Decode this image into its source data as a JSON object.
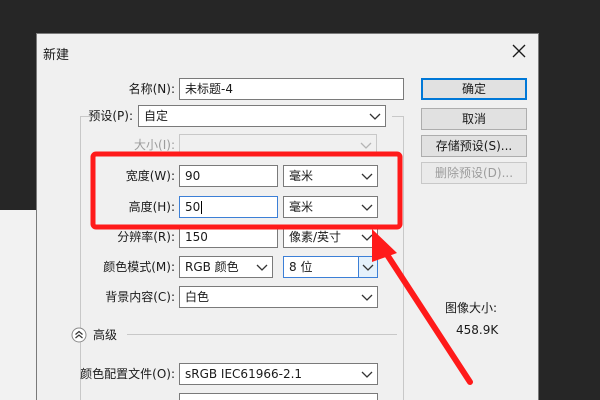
{
  "dialog": {
    "title": "新建"
  },
  "form": {
    "name": {
      "label": "名称(N):",
      "value": "未标题-4"
    },
    "preset": {
      "label": "预设(P):",
      "value": "自定"
    },
    "size": {
      "label": "大小(I):",
      "value": ""
    },
    "width": {
      "label": "宽度(W):",
      "value": "90",
      "unit": "毫米"
    },
    "height": {
      "label": "高度(H):",
      "value": "50",
      "unit": "毫米"
    },
    "resolution": {
      "label": "分辨率(R):",
      "value": "150",
      "unit": "像素/英寸"
    },
    "color_mode": {
      "label": "颜色模式(M):",
      "value": "RGB 颜色",
      "depth": "8 位"
    },
    "background": {
      "label": "背景内容(C):",
      "value": "白色"
    },
    "advanced": {
      "label": "高级"
    },
    "color_profile": {
      "label": "颜色配置文件(O):",
      "value": "sRGB IEC61966-2.1"
    }
  },
  "buttons": {
    "ok": "确定",
    "cancel": "取消",
    "save_preset": "存储预设(S)...",
    "delete_preset": "删除预设(D)..."
  },
  "info": {
    "image_size_label": "图像大小:",
    "image_size_value": "458.9K"
  },
  "annotation": {
    "color": "#ff1a1a",
    "icons": [
      "highlight-rectangle",
      "arrow"
    ]
  }
}
